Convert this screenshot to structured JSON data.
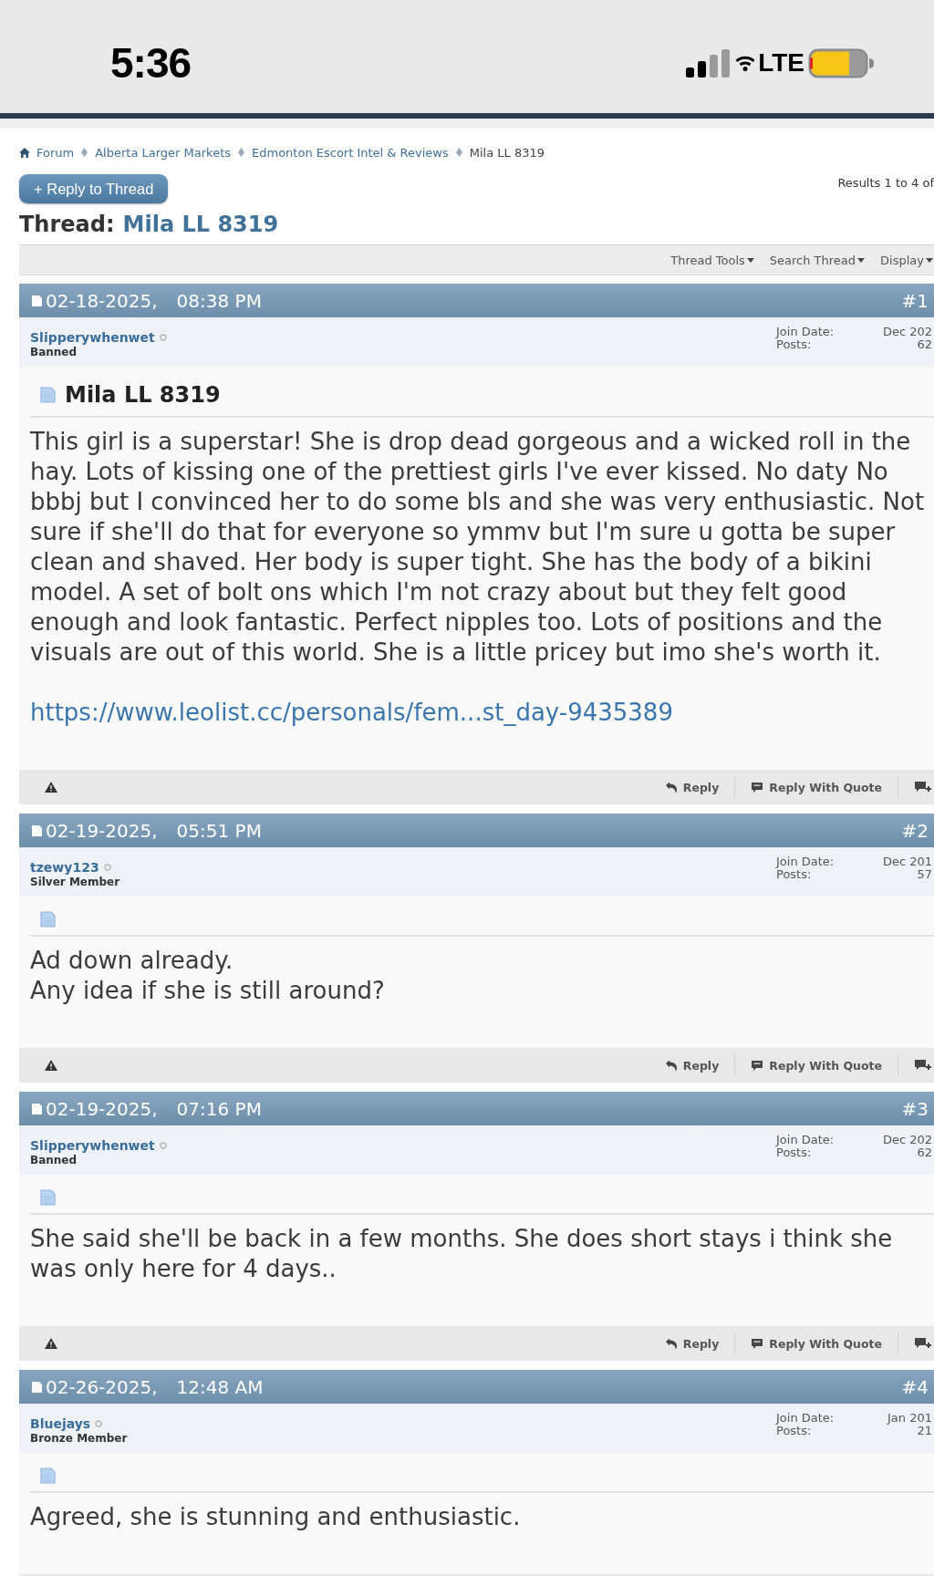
{
  "status_bar": {
    "time": "5:36",
    "network": "LTE"
  },
  "breadcrumb": [
    {
      "label": "Forum",
      "kind": "link"
    },
    {
      "label": "Alberta Larger Markets",
      "kind": "link"
    },
    {
      "label": "Edmonton Escort Intel & Reviews",
      "kind": "link"
    },
    {
      "label": "Mila LL 8319",
      "kind": "current"
    }
  ],
  "reply_button": "+ Reply to Thread",
  "results": "Results 1 to 4 of",
  "thread": {
    "prefix": "Thread:",
    "title": "Mila LL 8319"
  },
  "toolbar": [
    {
      "label": "Thread Tools"
    },
    {
      "label": "Search Thread"
    },
    {
      "label": "Display"
    }
  ],
  "posts": [
    {
      "date": "02-18-2025,",
      "time": "08:38 PM",
      "number": "#1",
      "username": "Slipperywhenwet",
      "rank": "Banned",
      "join_label": "Join Date:",
      "join_date": "Dec 202",
      "posts_label": "Posts:",
      "post_count": "62",
      "title": "Mila LL 8319",
      "lines": [
        "This girl is a superstar! She is drop dead gorgeous and a wicked roll in the hay. Lots of kissing one of the prettiest girls I've ever kissed. No daty No bbbj but I convinced her to do some bls and she was very enthusiastic. Not sure if she'll do that for everyone so ymmv but I'm sure u gotta be super clean and shaved. Her body is super tight. She has the body of a bikini model. A set of bolt ons which I'm not crazy about but they felt good enough and look fantastic. Perfect nipples too. Lots of positions and the visuals are out of this world. She is a little pricey but imo she's worth it."
      ],
      "link": "https://www.leolist.cc/personals/fem...st_day-9435389",
      "actions": [
        {
          "kind": "reply",
          "label": "Reply"
        },
        {
          "kind": "quote",
          "label": "Reply With Quote"
        },
        {
          "kind": "multiquote"
        }
      ]
    },
    {
      "date": "02-19-2025,",
      "time": "05:51 PM",
      "number": "#2",
      "username": "tzewy123",
      "rank": "Silver Member",
      "join_label": "Join Date:",
      "join_date": "Dec 201",
      "posts_label": "Posts:",
      "post_count": "57",
      "lines": [
        "Ad down already.",
        "Any idea if she is still around?"
      ],
      "actions": [
        {
          "kind": "reply",
          "label": "Reply"
        },
        {
          "kind": "quote",
          "label": "Reply With Quote"
        },
        {
          "kind": "multiquote"
        }
      ]
    },
    {
      "date": "02-19-2025,",
      "time": "07:16 PM",
      "number": "#3",
      "username": "Slipperywhenwet",
      "rank": "Banned",
      "join_label": "Join Date:",
      "join_date": "Dec 202",
      "posts_label": "Posts:",
      "post_count": "62",
      "lines": [
        "She said she'll be back in a few months. She does short stays i think she was only here for 4 days.."
      ],
      "actions": [
        {
          "kind": "reply",
          "label": "Reply"
        },
        {
          "kind": "quote",
          "label": "Reply With Quote"
        },
        {
          "kind": "multiquote"
        }
      ]
    },
    {
      "date": "02-26-2025,",
      "time": "12:48 AM",
      "number": "#4",
      "username": "Bluejays",
      "rank": "Bronze Member",
      "join_label": "Join Date:",
      "join_date": "Jan 201",
      "posts_label": "Posts:",
      "post_count": "21",
      "lines": [
        "Agreed, she is stunning and enthusiastic."
      ]
    }
  ]
}
